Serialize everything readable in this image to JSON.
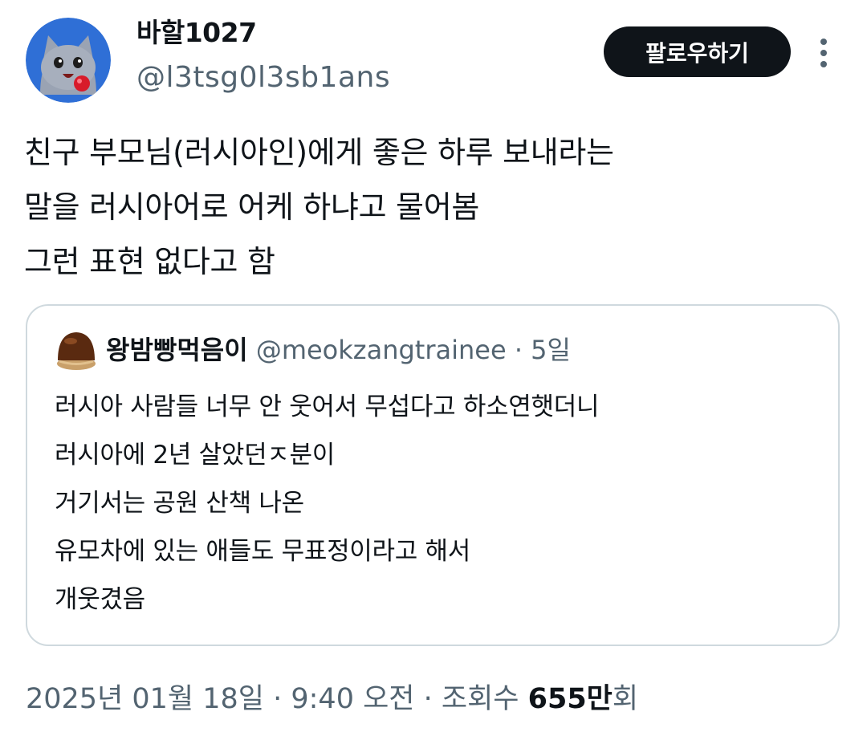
{
  "author": {
    "display_name": "바할1027",
    "handle": "@l3tsg0l3sb1ans",
    "avatar_icon": "cat-avatar-icon"
  },
  "follow_button_label": "팔로우하기",
  "more_icon": "more-vertical-icon",
  "tweet_lines": [
    "친구 부모님(러시아인)에게 좋은 하루 보내라는",
    "말을 러시아어로 어케 하냐고 물어봄",
    "그런 표현 없다고 함"
  ],
  "quote": {
    "display_name": "왕밤빵먹음이",
    "handle": "@meokzangtrainee",
    "separator": "·",
    "time": "5일",
    "avatar_icon": "chestnut-bread-avatar-icon",
    "lines": [
      "러시아 사람들 너무 안 웃어서 무섭다고 하소연햇더니",
      "러시아에 2년 살았던ㅈ분이",
      "거기서는 공원 산책 나온",
      "유모차에 있는 애들도 무표정이라고 해서",
      "개웃겼음"
    ]
  },
  "meta": {
    "date_time": "2025년 01월 18일 · 9:40 오전 · 조회수",
    "views": "655만",
    "views_suffix": "회"
  },
  "colors": {
    "text_primary": "#0f1419",
    "text_secondary": "#536471",
    "border": "#cfd9de",
    "button_bg": "#0f1419",
    "avatar_bg": "#2f6fd6"
  }
}
